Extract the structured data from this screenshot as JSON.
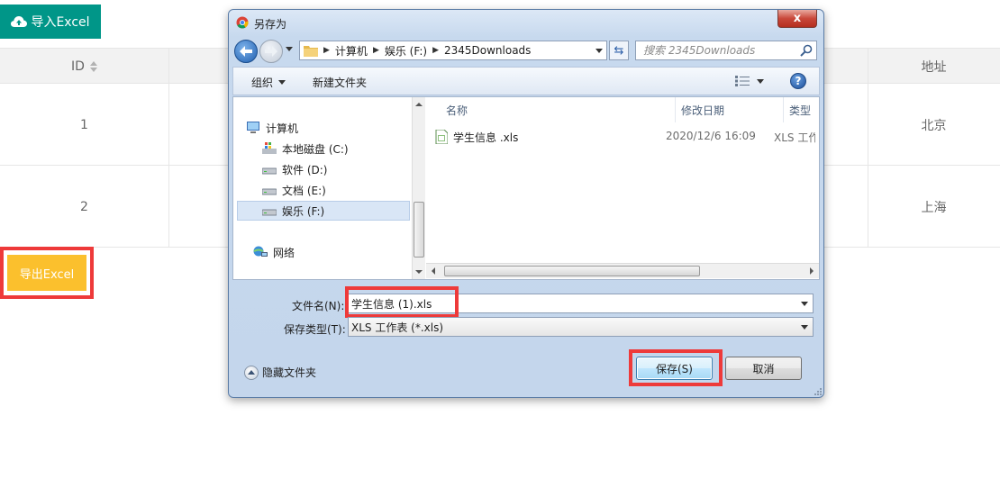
{
  "page": {
    "import_label": "导入Excel",
    "export_label": "导出Excel",
    "table": {
      "headers": {
        "id": "ID",
        "address": "地址"
      },
      "rows": [
        {
          "id": "1",
          "address": "北京"
        },
        {
          "id": "2",
          "address": "上海"
        }
      ]
    }
  },
  "dialog": {
    "title": "另存为",
    "close_label": "x",
    "breadcrumb": [
      "计算机",
      "娱乐 (F:)",
      "2345Downloads"
    ],
    "search_placeholder": "搜索 2345Downloads",
    "toolbar": {
      "organize": "组织",
      "new_folder": "新建文件夹",
      "help": "?"
    },
    "nav_items": [
      {
        "label": "计算机",
        "icon": "computer-icon"
      },
      {
        "label": "本地磁盘 (C:)",
        "icon": "local-disk-icon"
      },
      {
        "label": "软件 (D:)",
        "icon": "drive-icon"
      },
      {
        "label": "文档 (E:)",
        "icon": "drive-icon"
      },
      {
        "label": "娱乐 (F:)",
        "icon": "drive-icon",
        "selected": true
      },
      {
        "label": "网络",
        "icon": "network-icon"
      }
    ],
    "columns": {
      "name": "名称",
      "modified": "修改日期",
      "type": "类型"
    },
    "files": [
      {
        "name": "学生信息 .xls",
        "modified": "2020/12/6 16:09",
        "type": "XLS 工作表"
      }
    ],
    "filename_label": "文件名(N):",
    "filename_value": "学生信息 (1).xls",
    "filetype_label": "保存类型(T):",
    "filetype_value": "XLS 工作表 (*.xls)",
    "hide_folders": "隐藏文件夹",
    "save_label": "保存(S)",
    "cancel_label": "取消"
  },
  "colors": {
    "import_button": "#009688",
    "export_button": "#fbc02d",
    "highlight": "#ee3a3a",
    "dialog_frame": "#c4d6ec"
  }
}
